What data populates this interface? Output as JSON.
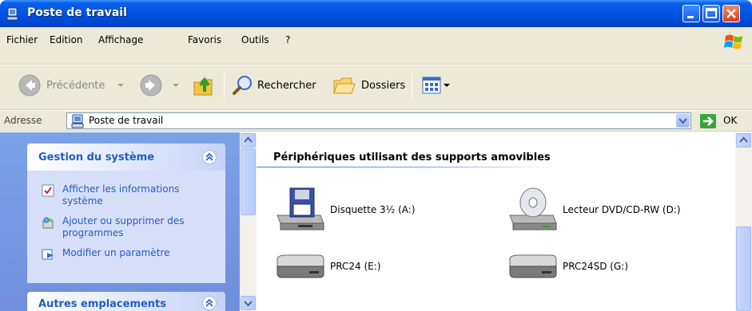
{
  "window": {
    "title": "Poste de travail"
  },
  "menu": {
    "items": [
      {
        "label": "Fichier"
      },
      {
        "label": "Edition"
      },
      {
        "label": "Affichage"
      },
      {
        "label": "Favoris"
      },
      {
        "label": "Outils"
      },
      {
        "label": "?"
      }
    ]
  },
  "toolbar": {
    "back_label": "Précédente",
    "search_label": "Rechercher",
    "folders_label": "Dossiers"
  },
  "address": {
    "label": "Adresse",
    "value": "Poste de travail",
    "go_label": "OK"
  },
  "tasks": {
    "system_title": "Gestion du système",
    "links": [
      {
        "label": "Afficher les informations système"
      },
      {
        "label": "Ajouter ou supprimer des programmes"
      },
      {
        "label": "Modifier un paramètre"
      }
    ],
    "other_title": "Autres emplacements"
  },
  "content": {
    "group_title": "Périphériques utilisant des supports amovibles",
    "drives": [
      {
        "label": "Disquette 3½ (A:)",
        "icon": "floppy-drive-icon"
      },
      {
        "label": "Lecteur DVD/CD-RW (D:)",
        "icon": "dvd-drive-icon"
      },
      {
        "label": "PRC24 (E:)",
        "icon": "removable-drive-icon"
      },
      {
        "label": "PRC24SD (G:)",
        "icon": "removable-drive-icon"
      }
    ]
  },
  "colors": {
    "titlebar": "#0054e3",
    "taskpane": "#6f8fdc",
    "task_link": "#215dc6"
  }
}
